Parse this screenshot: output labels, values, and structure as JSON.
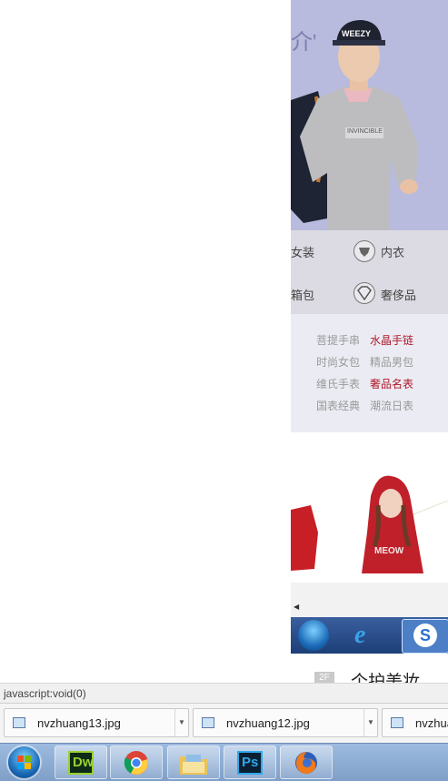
{
  "web": {
    "hero_text": "介'",
    "cap_text": "WEEZY",
    "shirt_text": "INVINCIBLE",
    "categories": [
      {
        "label": "女装",
        "icon": "none"
      },
      {
        "label": "内衣",
        "icon": "underwear-icon"
      },
      {
        "label": "箱包",
        "icon": "none"
      },
      {
        "label": "奢侈品",
        "icon": "diamond-icon"
      }
    ],
    "links": [
      [
        "菩提手串",
        "水晶手链"
      ],
      [
        "时尚女包",
        "精品男包"
      ],
      [
        "维氏手表",
        "奢品名表"
      ],
      [
        "国表经典",
        "潮流日表"
      ]
    ],
    "promo_text": "MEOW",
    "section2_badge": "2F",
    "section2_title": "个护美妆"
  },
  "status_bar": {
    "text": "javascript:void(0)"
  },
  "downloads": [
    {
      "name": "nvzhuang13.jpg"
    },
    {
      "name": "nvzhuang12.jpg"
    },
    {
      "name": "nvzhua"
    }
  ],
  "taskbar": {
    "apps": [
      {
        "label": "Dw",
        "icon": "dreamweaver-icon",
        "color": "#9ad02f"
      },
      {
        "label": "",
        "icon": "chrome-icon"
      },
      {
        "label": "",
        "icon": "folder-icon"
      },
      {
        "label": "Ps",
        "icon": "photoshop-icon",
        "color": "#2fa8e8"
      },
      {
        "label": "",
        "icon": "firefox-icon"
      }
    ]
  },
  "colors": {
    "accent_red": "#b0182a",
    "hero_bg": "#b8bbdd",
    "taskbar": "#9dbbe0"
  }
}
